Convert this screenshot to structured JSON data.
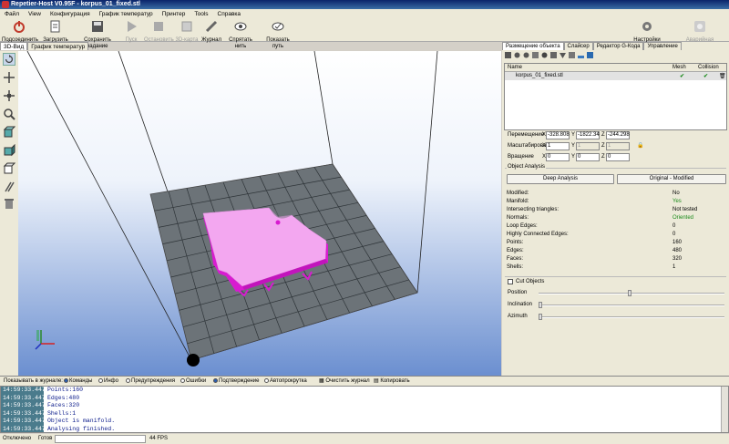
{
  "window": {
    "title": "Repetier-Host V0.95F - korpus_01_fixed.stl"
  },
  "menu": [
    "Файл",
    "View",
    "Конфигурация",
    "График температур",
    "Принтер",
    "Tools",
    "Справка"
  ],
  "toolbar": {
    "items": [
      {
        "label": "Подсоединить",
        "icon": "power-icon",
        "enabled": true
      },
      {
        "label": "Загрузить",
        "icon": "load-icon",
        "enabled": true
      },
      {
        "label": "Сохранить задание",
        "icon": "save-icon",
        "enabled": true
      },
      {
        "label": "Пуск",
        "icon": "play-icon",
        "enabled": false
      },
      {
        "label": "Остановить",
        "icon": "stop-icon",
        "enabled": false
      },
      {
        "label": "3D-карта",
        "icon": "map-icon",
        "enabled": false
      },
      {
        "label": "Журнал",
        "icon": "pencil-icon",
        "enabled": true
      },
      {
        "label": "Спрятать нить",
        "icon": "eye-icon",
        "enabled": true
      },
      {
        "label": "Показать путь",
        "icon": "eye-check-icon",
        "enabled": true
      }
    ],
    "printer_settings": "Настройки принтера",
    "emergency_stop": "Аварийная остановка"
  },
  "left_tabs": [
    "3D-Вид",
    "График температур"
  ],
  "right_tabs": [
    "Размещение объекта",
    "Слайсер",
    "Редактор G-Кода",
    "Управление"
  ],
  "objects": {
    "headers": {
      "name": "Name",
      "mesh": "Mesh",
      "collision": "Collision"
    },
    "rows": [
      {
        "name": "korpus_01_fixed.stl",
        "mesh": "ok",
        "collision": "ok"
      }
    ]
  },
  "transform": {
    "translate_label": "Перемещение",
    "translate": {
      "x": "-328.808",
      "y": "-1822.34",
      "z": "-244.298"
    },
    "scale_label": "Масштабирование",
    "scale": {
      "x": "1",
      "y": "1",
      "z": "1"
    },
    "rotate_label": "Вращение",
    "rotate": {
      "x": "0",
      "y": "0",
      "z": "0"
    },
    "axis": {
      "x": "X",
      "y": "Y",
      "z": "Z"
    }
  },
  "analysis": {
    "title": "Object Analysis",
    "deep_button": "Deep Analysis",
    "original_button": "Original - Modified",
    "rows": [
      {
        "name": "Modified:",
        "value": "No"
      },
      {
        "name": "Manifold:",
        "value": "Yes",
        "color": "#1a8a1a"
      },
      {
        "name": "Intersecting triangles:",
        "value": "Not tested"
      },
      {
        "name": "Normals:",
        "value": "Oriented",
        "color": "#1a8a1a"
      },
      {
        "name": "Loop Edges:",
        "value": "0"
      },
      {
        "name": "Highly Connected Edges:",
        "value": "0"
      },
      {
        "name": "Points:",
        "value": "160"
      },
      {
        "name": "Edges:",
        "value": "480"
      },
      {
        "name": "Faces:",
        "value": "320"
      },
      {
        "name": "Shells:",
        "value": "1"
      }
    ]
  },
  "cut": {
    "title": "Cut Objects",
    "position_label": "Position",
    "inclination_label": "Inclination",
    "azimuth_label": "Azimuth",
    "position": 0.5,
    "inclination": 0.0,
    "azimuth": 0.0
  },
  "logbar": {
    "label": "Показывать в журнале:",
    "options": [
      {
        "label": "Команды",
        "on": true
      },
      {
        "label": "Инфо",
        "on": false
      },
      {
        "label": "Предупреждения",
        "on": false
      },
      {
        "label": "Ошибки",
        "on": false
      },
      {
        "label": "Подтверждение",
        "on": true
      },
      {
        "label": "Автопрокрутка",
        "on": false
      }
    ],
    "clear": "Очистить журнал",
    "copy": "Копировать"
  },
  "log": [
    {
      "time": "14:59:33.447",
      "msg": "Points:160"
    },
    {
      "time": "14:59:33.447",
      "msg": "Edges:480"
    },
    {
      "time": "14:59:33.447",
      "msg": "Faces:320"
    },
    {
      "time": "14:59:33.447",
      "msg": "Shells:1"
    },
    {
      "time": "14:59:33.447",
      "msg": "Object is manifold."
    },
    {
      "time": "14:59:33.447",
      "msg": "Analysing finished."
    }
  ],
  "status": {
    "connection": "Отключено",
    "state": "Готов",
    "fps": "44 FPS"
  },
  "colors": {
    "object": "#f3a7f0",
    "object_side": "#d81bd0",
    "grid": "#6c7378"
  }
}
